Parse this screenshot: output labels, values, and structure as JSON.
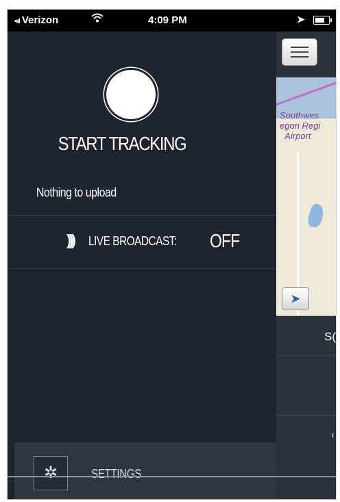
{
  "status_bar": {
    "signal": "•ııl",
    "carrier": "Verizon",
    "wifi_icon": "wifi-icon",
    "time": "4:09 PM",
    "location_icon": "location-arrow-icon",
    "battery_level": 0.7
  },
  "side_menu": {
    "record_button_icon": "record-circle-icon",
    "tracking_label": "START TRACKING",
    "upload_status": "Nothing to upload",
    "broadcast": {
      "icon": "broadcast-icon",
      "label": "LIVE BROADCAST:",
      "value": "OFF"
    },
    "settings": {
      "icon": "gear-icon",
      "label": "SETTINGS"
    }
  },
  "main_panel": {
    "menu_button_icon": "hamburger-menu-icon",
    "map": {
      "place_label": "Southwest\nOregon Regional\nAirport",
      "place_label_visible": "Southwes\negon Regi\nAirport"
    },
    "locate_button_icon": "navigation-arrow-icon",
    "partial_label": "S(",
    "partial_tick": "ı"
  },
  "colors": {
    "menu_background": "#1f252e",
    "text": "#ffffff",
    "map_label": "#7a3f92",
    "locate_arrow": "#2f5fb3"
  }
}
